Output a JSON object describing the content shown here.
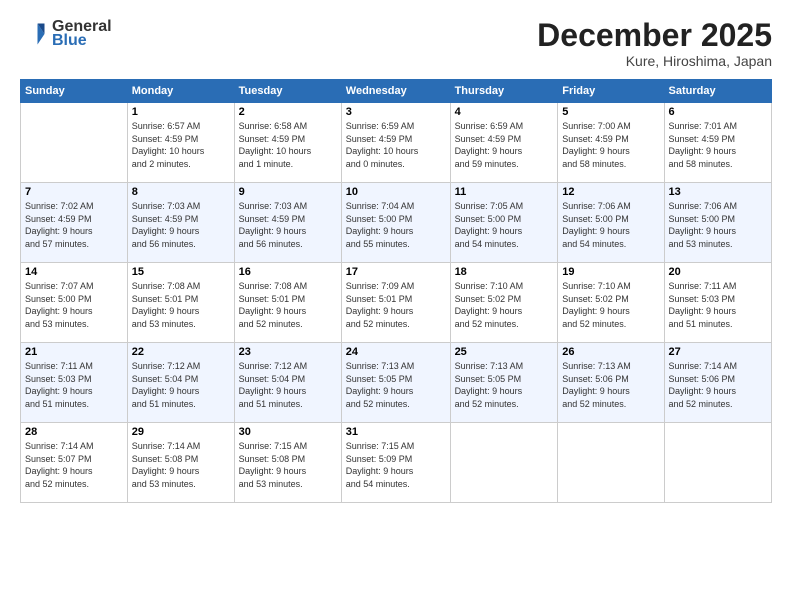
{
  "header": {
    "logo_general": "General",
    "logo_blue": "Blue",
    "month_title": "December 2025",
    "subtitle": "Kure, Hiroshima, Japan"
  },
  "days_of_week": [
    "Sunday",
    "Monday",
    "Tuesday",
    "Wednesday",
    "Thursday",
    "Friday",
    "Saturday"
  ],
  "weeks": [
    [
      {
        "day": "",
        "info": ""
      },
      {
        "day": "1",
        "info": "Sunrise: 6:57 AM\nSunset: 4:59 PM\nDaylight: 10 hours\nand 2 minutes."
      },
      {
        "day": "2",
        "info": "Sunrise: 6:58 AM\nSunset: 4:59 PM\nDaylight: 10 hours\nand 1 minute."
      },
      {
        "day": "3",
        "info": "Sunrise: 6:59 AM\nSunset: 4:59 PM\nDaylight: 10 hours\nand 0 minutes."
      },
      {
        "day": "4",
        "info": "Sunrise: 6:59 AM\nSunset: 4:59 PM\nDaylight: 9 hours\nand 59 minutes."
      },
      {
        "day": "5",
        "info": "Sunrise: 7:00 AM\nSunset: 4:59 PM\nDaylight: 9 hours\nand 58 minutes."
      },
      {
        "day": "6",
        "info": "Sunrise: 7:01 AM\nSunset: 4:59 PM\nDaylight: 9 hours\nand 58 minutes."
      }
    ],
    [
      {
        "day": "7",
        "info": "Sunrise: 7:02 AM\nSunset: 4:59 PM\nDaylight: 9 hours\nand 57 minutes."
      },
      {
        "day": "8",
        "info": "Sunrise: 7:03 AM\nSunset: 4:59 PM\nDaylight: 9 hours\nand 56 minutes."
      },
      {
        "day": "9",
        "info": "Sunrise: 7:03 AM\nSunset: 4:59 PM\nDaylight: 9 hours\nand 56 minutes."
      },
      {
        "day": "10",
        "info": "Sunrise: 7:04 AM\nSunset: 5:00 PM\nDaylight: 9 hours\nand 55 minutes."
      },
      {
        "day": "11",
        "info": "Sunrise: 7:05 AM\nSunset: 5:00 PM\nDaylight: 9 hours\nand 54 minutes."
      },
      {
        "day": "12",
        "info": "Sunrise: 7:06 AM\nSunset: 5:00 PM\nDaylight: 9 hours\nand 54 minutes."
      },
      {
        "day": "13",
        "info": "Sunrise: 7:06 AM\nSunset: 5:00 PM\nDaylight: 9 hours\nand 53 minutes."
      }
    ],
    [
      {
        "day": "14",
        "info": "Sunrise: 7:07 AM\nSunset: 5:00 PM\nDaylight: 9 hours\nand 53 minutes."
      },
      {
        "day": "15",
        "info": "Sunrise: 7:08 AM\nSunset: 5:01 PM\nDaylight: 9 hours\nand 53 minutes."
      },
      {
        "day": "16",
        "info": "Sunrise: 7:08 AM\nSunset: 5:01 PM\nDaylight: 9 hours\nand 52 minutes."
      },
      {
        "day": "17",
        "info": "Sunrise: 7:09 AM\nSunset: 5:01 PM\nDaylight: 9 hours\nand 52 minutes."
      },
      {
        "day": "18",
        "info": "Sunrise: 7:10 AM\nSunset: 5:02 PM\nDaylight: 9 hours\nand 52 minutes."
      },
      {
        "day": "19",
        "info": "Sunrise: 7:10 AM\nSunset: 5:02 PM\nDaylight: 9 hours\nand 52 minutes."
      },
      {
        "day": "20",
        "info": "Sunrise: 7:11 AM\nSunset: 5:03 PM\nDaylight: 9 hours\nand 51 minutes."
      }
    ],
    [
      {
        "day": "21",
        "info": "Sunrise: 7:11 AM\nSunset: 5:03 PM\nDaylight: 9 hours\nand 51 minutes."
      },
      {
        "day": "22",
        "info": "Sunrise: 7:12 AM\nSunset: 5:04 PM\nDaylight: 9 hours\nand 51 minutes."
      },
      {
        "day": "23",
        "info": "Sunrise: 7:12 AM\nSunset: 5:04 PM\nDaylight: 9 hours\nand 51 minutes."
      },
      {
        "day": "24",
        "info": "Sunrise: 7:13 AM\nSunset: 5:05 PM\nDaylight: 9 hours\nand 52 minutes."
      },
      {
        "day": "25",
        "info": "Sunrise: 7:13 AM\nSunset: 5:05 PM\nDaylight: 9 hours\nand 52 minutes."
      },
      {
        "day": "26",
        "info": "Sunrise: 7:13 AM\nSunset: 5:06 PM\nDaylight: 9 hours\nand 52 minutes."
      },
      {
        "day": "27",
        "info": "Sunrise: 7:14 AM\nSunset: 5:06 PM\nDaylight: 9 hours\nand 52 minutes."
      }
    ],
    [
      {
        "day": "28",
        "info": "Sunrise: 7:14 AM\nSunset: 5:07 PM\nDaylight: 9 hours\nand 52 minutes."
      },
      {
        "day": "29",
        "info": "Sunrise: 7:14 AM\nSunset: 5:08 PM\nDaylight: 9 hours\nand 53 minutes."
      },
      {
        "day": "30",
        "info": "Sunrise: 7:15 AM\nSunset: 5:08 PM\nDaylight: 9 hours\nand 53 minutes."
      },
      {
        "day": "31",
        "info": "Sunrise: 7:15 AM\nSunset: 5:09 PM\nDaylight: 9 hours\nand 54 minutes."
      },
      {
        "day": "",
        "info": ""
      },
      {
        "day": "",
        "info": ""
      },
      {
        "day": "",
        "info": ""
      }
    ]
  ]
}
